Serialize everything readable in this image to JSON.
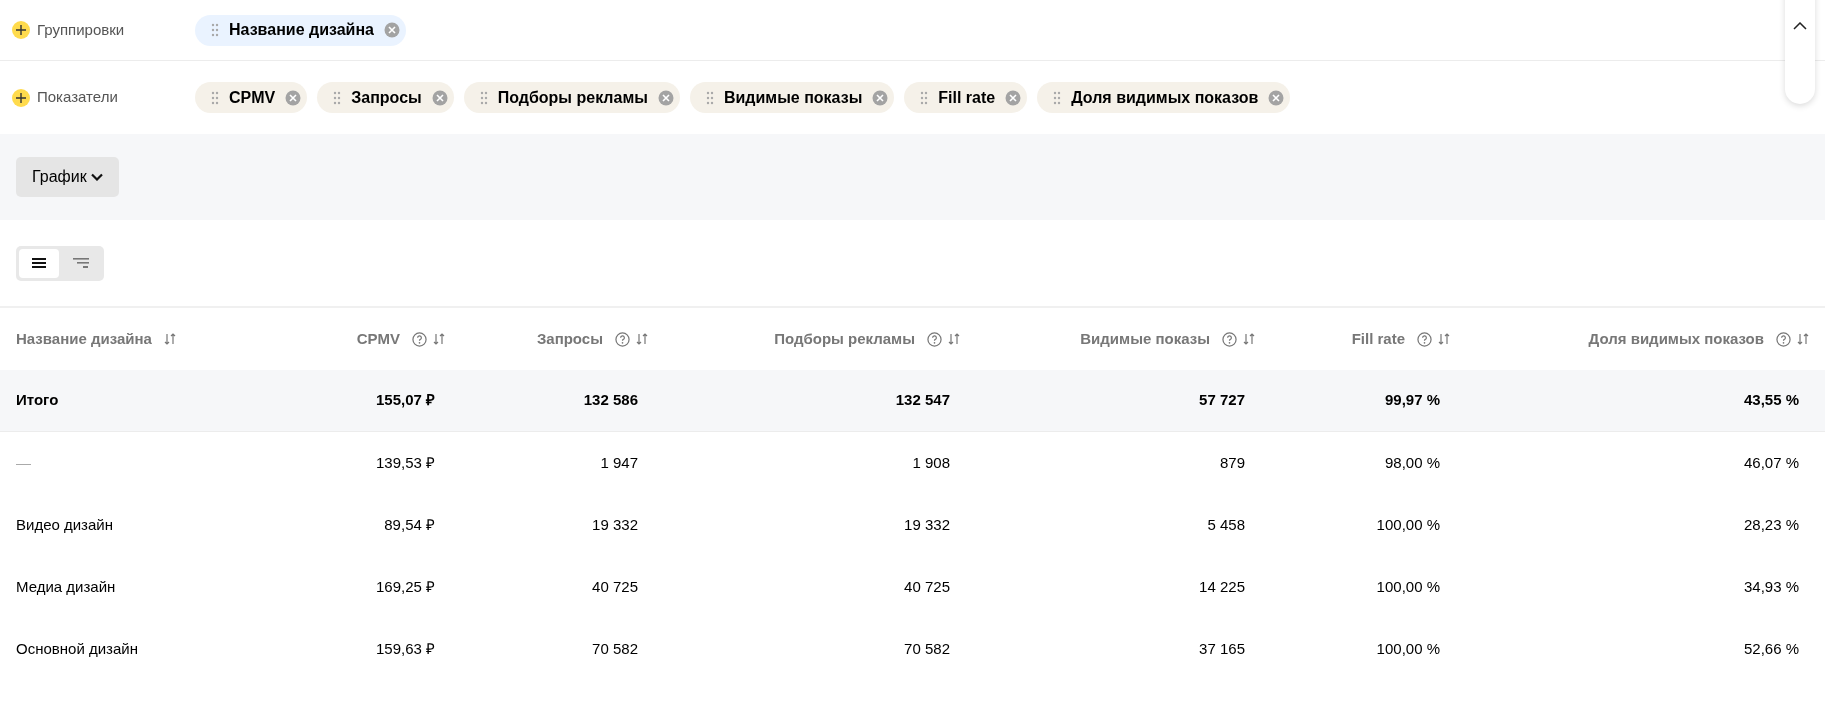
{
  "groupings": {
    "label": "Группировки",
    "chips": [
      {
        "label": "Название дизайна"
      }
    ]
  },
  "metrics": {
    "label": "Показатели",
    "chips": [
      {
        "label": "CPMV"
      },
      {
        "label": "Запросы"
      },
      {
        "label": "Подборы рекламы"
      },
      {
        "label": "Видимые показы"
      },
      {
        "label": "Fill rate"
      },
      {
        "label": "Доля видимых показов"
      }
    ]
  },
  "chart_button": {
    "label": "График"
  },
  "view_toggle": [
    {
      "kind": "flat",
      "selected": true
    },
    {
      "kind": "tree",
      "selected": false
    }
  ],
  "table": {
    "columns": [
      {
        "label": "Название дизайна",
        "help": false
      },
      {
        "label": "CPMV",
        "help": true
      },
      {
        "label": "Запросы",
        "help": true
      },
      {
        "label": "Подборы рекламы",
        "help": true
      },
      {
        "label": "Видимые показы",
        "help": true
      },
      {
        "label": "Fill rate",
        "help": true
      },
      {
        "label": "Доля видимых показов",
        "help": true
      }
    ],
    "total": [
      "Итого",
      "155,07 ₽",
      "132 586",
      "132 547",
      "57 727",
      "99,97 %",
      "43,55 %"
    ],
    "rows": [
      [
        "—",
        "139,53 ₽",
        "1 947",
        "1 908",
        "879",
        "98,00 %",
        "46,07 %"
      ],
      [
        "Видео дизайн",
        "89,54 ₽",
        "19 332",
        "19 332",
        "5 458",
        "100,00 %",
        "28,23 %"
      ],
      [
        "Медиа дизайн",
        "169,25 ₽",
        "40 725",
        "40 725",
        "14 225",
        "100,00 %",
        "34,93 %"
      ],
      [
        "Основной дизайн",
        "159,63 ₽",
        "70 582",
        "70 582",
        "37 165",
        "100,00 %",
        "52,66 %"
      ]
    ]
  }
}
